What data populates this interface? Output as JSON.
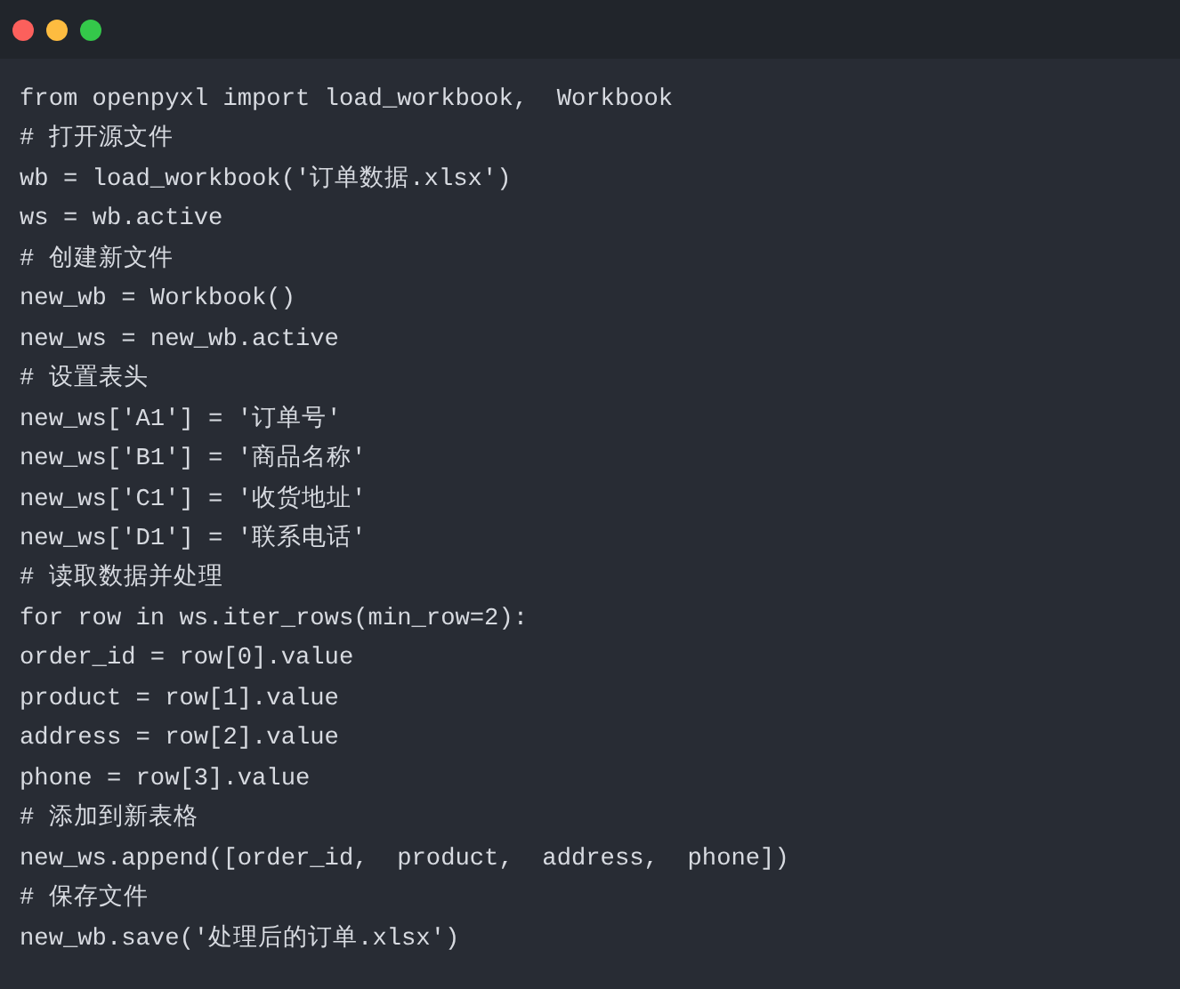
{
  "window": {
    "controls": [
      {
        "color": "#fc605c"
      },
      {
        "color": "#fdbc40"
      },
      {
        "color": "#34c84a"
      }
    ]
  },
  "code_lines": [
    "from openpyxl import load_workbook,  Workbook",
    "# 打开源文件",
    "wb = load_workbook('订单数据.xlsx')",
    "ws = wb.active",
    "# 创建新文件",
    "new_wb = Workbook()",
    "new_ws = new_wb.active",
    "# 设置表头",
    "new_ws['A1'] = '订单号'",
    "new_ws['B1'] = '商品名称'",
    "new_ws['C1'] = '收货地址'",
    "new_ws['D1'] = '联系电话'",
    "# 读取数据并处理",
    "for row in ws.iter_rows(min_row=2):",
    "order_id = row[0].value",
    "product = row[1].value",
    "address = row[2].value",
    "phone = row[3].value",
    "# 添加到新表格",
    "new_ws.append([order_id,  product,  address,  phone])",
    "# 保存文件",
    "new_wb.save('处理后的订单.xlsx')"
  ]
}
